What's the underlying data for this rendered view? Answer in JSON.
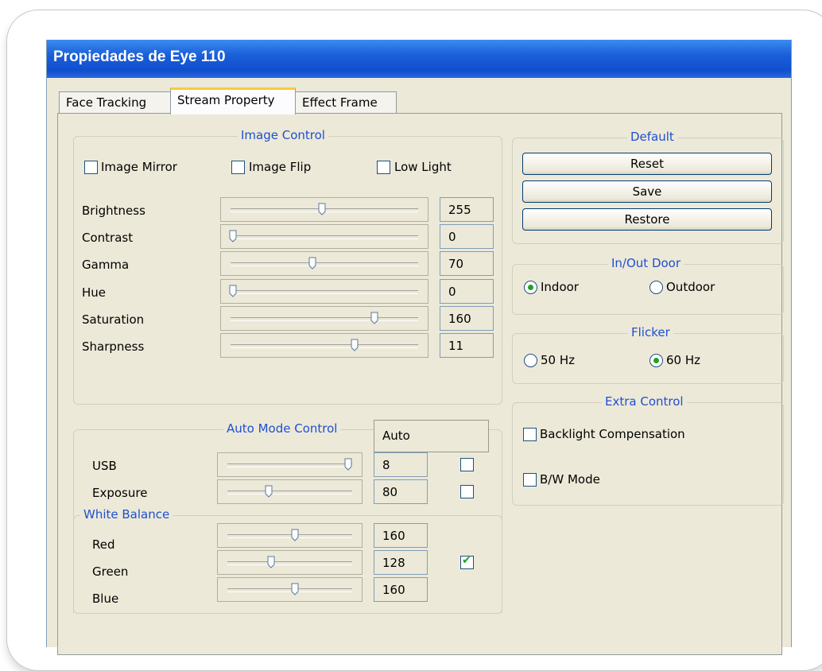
{
  "window": {
    "title": "Propiedades de Eye 110"
  },
  "tabs": [
    {
      "label": "Face Tracking",
      "active": false
    },
    {
      "label": "Stream Property",
      "active": true
    },
    {
      "label": "Effect Frame",
      "active": false
    }
  ],
  "image_control": {
    "legend": "Image Control",
    "checkboxes": [
      {
        "label": "Image Mirror",
        "checked": false
      },
      {
        "label": "Image Flip",
        "checked": false
      },
      {
        "label": "Low Light",
        "checked": false
      }
    ],
    "sliders": [
      {
        "label": "Brightness",
        "value": "255",
        "level": 0.49
      },
      {
        "label": "Contrast",
        "value": "0",
        "level": 0.0
      },
      {
        "label": "Gamma",
        "value": "70",
        "level": 0.44
      },
      {
        "label": "Hue",
        "value": "0",
        "level": 0.0
      },
      {
        "label": "Saturation",
        "value": "160",
        "level": 0.78
      },
      {
        "label": "Sharpness",
        "value": "11",
        "level": 0.67
      }
    ]
  },
  "auto_mode": {
    "legend": "Auto Mode Control",
    "header": "Auto",
    "rows": [
      {
        "label": "USB",
        "value": "8",
        "level": 1.0,
        "auto": false
      },
      {
        "label": "Exposure",
        "value": "80",
        "level": 0.33,
        "auto": false
      }
    ]
  },
  "white_balance": {
    "legend": "White Balance",
    "rows": [
      {
        "label": "Red",
        "value": "160",
        "level": 0.55
      },
      {
        "label": "Green",
        "value": "128",
        "level": 0.35
      },
      {
        "label": "Blue",
        "value": "160",
        "level": 0.55
      }
    ],
    "auto": true
  },
  "default_group": {
    "legend": "Default",
    "buttons": [
      "Reset",
      "Save",
      "Restore"
    ]
  },
  "door": {
    "legend": "In/Out Door",
    "options": [
      {
        "label": "Indoor",
        "checked": true
      },
      {
        "label": "Outdoor",
        "checked": false
      }
    ]
  },
  "flicker": {
    "legend": "Flicker",
    "options": [
      {
        "label": "50 Hz",
        "checked": false
      },
      {
        "label": "60 Hz",
        "checked": true
      }
    ]
  },
  "extra_control": {
    "legend": "Extra Control",
    "checkboxes": [
      {
        "label": "Backlight Compensation",
        "checked": false
      },
      {
        "label": "B/W Mode",
        "checked": false
      }
    ]
  },
  "colors": {
    "title_bar": "#0f4fce",
    "window_bg": "#ECE9D8",
    "legend_text": "#1f4fd1",
    "check_green": "#21a121"
  }
}
